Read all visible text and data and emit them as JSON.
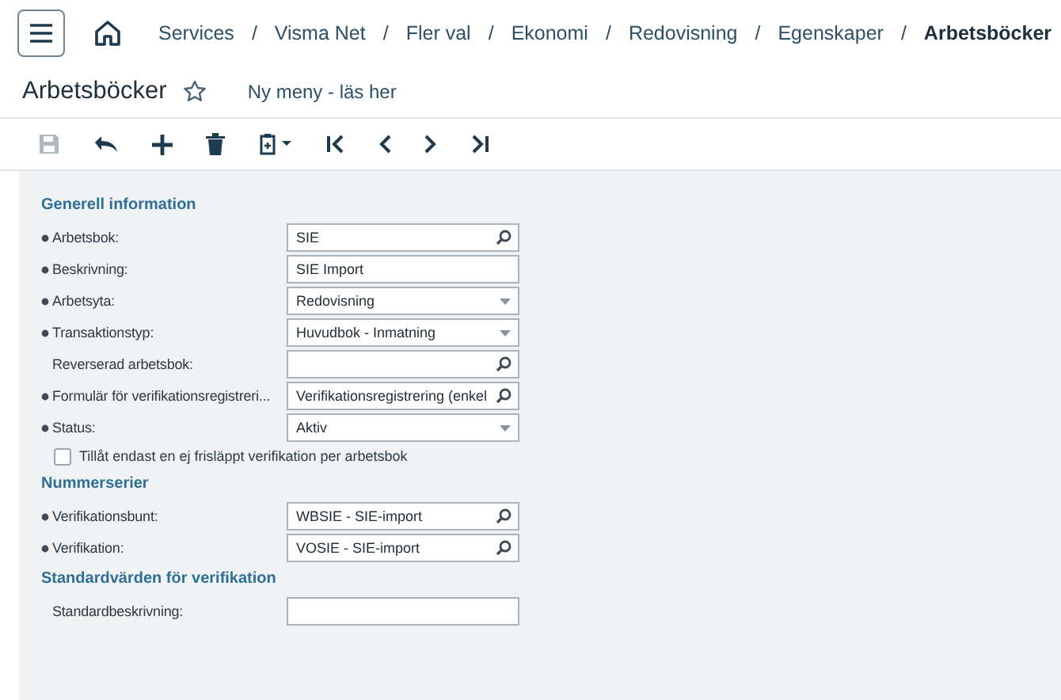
{
  "breadcrumb": [
    {
      "label": "Services",
      "current": false
    },
    {
      "label": "Visma Net",
      "current": false
    },
    {
      "label": "Fler val",
      "current": false
    },
    {
      "label": "Ekonomi",
      "current": false
    },
    {
      "label": "Redovisning",
      "current": false
    },
    {
      "label": "Egenskaper",
      "current": false
    },
    {
      "label": "Arbetsböcker",
      "current": true
    }
  ],
  "separator": "/",
  "page_title": "Arbetsböcker",
  "favorite": false,
  "menu_link": "Ny meny - läs her",
  "toolbar": [
    {
      "kind": "save",
      "disabled": true
    },
    {
      "kind": "undo",
      "disabled": false
    },
    {
      "kind": "add",
      "disabled": false
    },
    {
      "kind": "delete",
      "disabled": false
    },
    {
      "kind": "clipboard",
      "disabled": false
    },
    {
      "kind": "first",
      "disabled": false
    },
    {
      "kind": "prev",
      "disabled": false
    },
    {
      "kind": "next",
      "disabled": false
    },
    {
      "kind": "last",
      "disabled": false
    }
  ],
  "sections": [
    {
      "title": "Generell information",
      "rows": [
        {
          "kind": "lookup",
          "label": "Arbetsbok:",
          "required": true,
          "value": "SIE"
        },
        {
          "kind": "text",
          "label": "Beskrivning:",
          "required": true,
          "value": "SIE Import"
        },
        {
          "kind": "select",
          "label": "Arbetsyta:",
          "required": true,
          "value": "Redovisning"
        },
        {
          "kind": "select",
          "label": "Transaktionstyp:",
          "required": true,
          "value": "Huvudbok - Inmatning"
        },
        {
          "kind": "lookup",
          "label": "Reverserad arbetsbok:",
          "required": false
        },
        {
          "kind": "lookup",
          "label": "Formulär för verifikationsregistreri...",
          "required": true,
          "value": "Verifikationsregistrering (enkel"
        },
        {
          "kind": "select",
          "label": "Status:",
          "required": true,
          "value": "Aktiv"
        },
        {
          "kind": "checkbox",
          "label": "Tillåt endast en ej frisläppt verifikation per arbetsbok",
          "checked": false
        }
      ]
    },
    {
      "title": "Nummerserier",
      "rows": [
        {
          "kind": "lookup",
          "label": "Verifikationsbunt:",
          "required": true,
          "value": "WBSIE - SIE-import"
        },
        {
          "kind": "lookup",
          "label": "Verifikation:",
          "required": true,
          "value": "VOSIE - SIE-import"
        }
      ]
    },
    {
      "title": "Standardvärden för verifikation",
      "rows": [
        {
          "kind": "text",
          "label": "Standardbeskrivning:",
          "required": false
        }
      ]
    }
  ]
}
